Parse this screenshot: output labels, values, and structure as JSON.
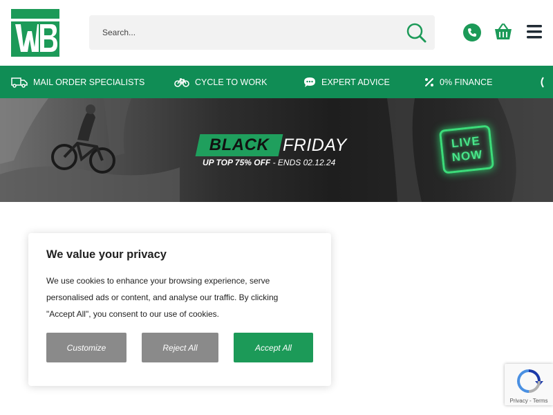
{
  "header": {
    "logo_alt": "WB",
    "search_placeholder": "Search..."
  },
  "usp_bar": {
    "items": [
      {
        "label": "MAIL ORDER SPECIALISTS",
        "icon": "van-icon"
      },
      {
        "label": "CYCLE TO WORK",
        "icon": "bicycle-icon"
      },
      {
        "label": "EXPERT ADVICE",
        "icon": "chat-icon"
      },
      {
        "label": "0% FINANCE",
        "icon": "percent-icon"
      }
    ]
  },
  "banner": {
    "black": "BLACK",
    "friday": "FRIDAY",
    "offer": "UP TOP 75% OFF",
    "ends": " - ENDS 02.12.24",
    "live_line1": "LIVE",
    "live_line2": "NOW"
  },
  "cookie_modal": {
    "title": "We value your privacy",
    "text": "We use cookies to enhance your browsing experience, serve personalised ads or content, and analyse our traffic. By clicking \"Accept All\", you consent to our use of cookies.",
    "customize_label": "Customize",
    "reject_label": "Reject All",
    "accept_label": "Accept All"
  },
  "recaptcha": {
    "links": "Privacy - Terms"
  },
  "colors": {
    "brand_green": "#108d55",
    "accept_green": "#1c9a58",
    "button_grey": "#8a8a8a"
  }
}
